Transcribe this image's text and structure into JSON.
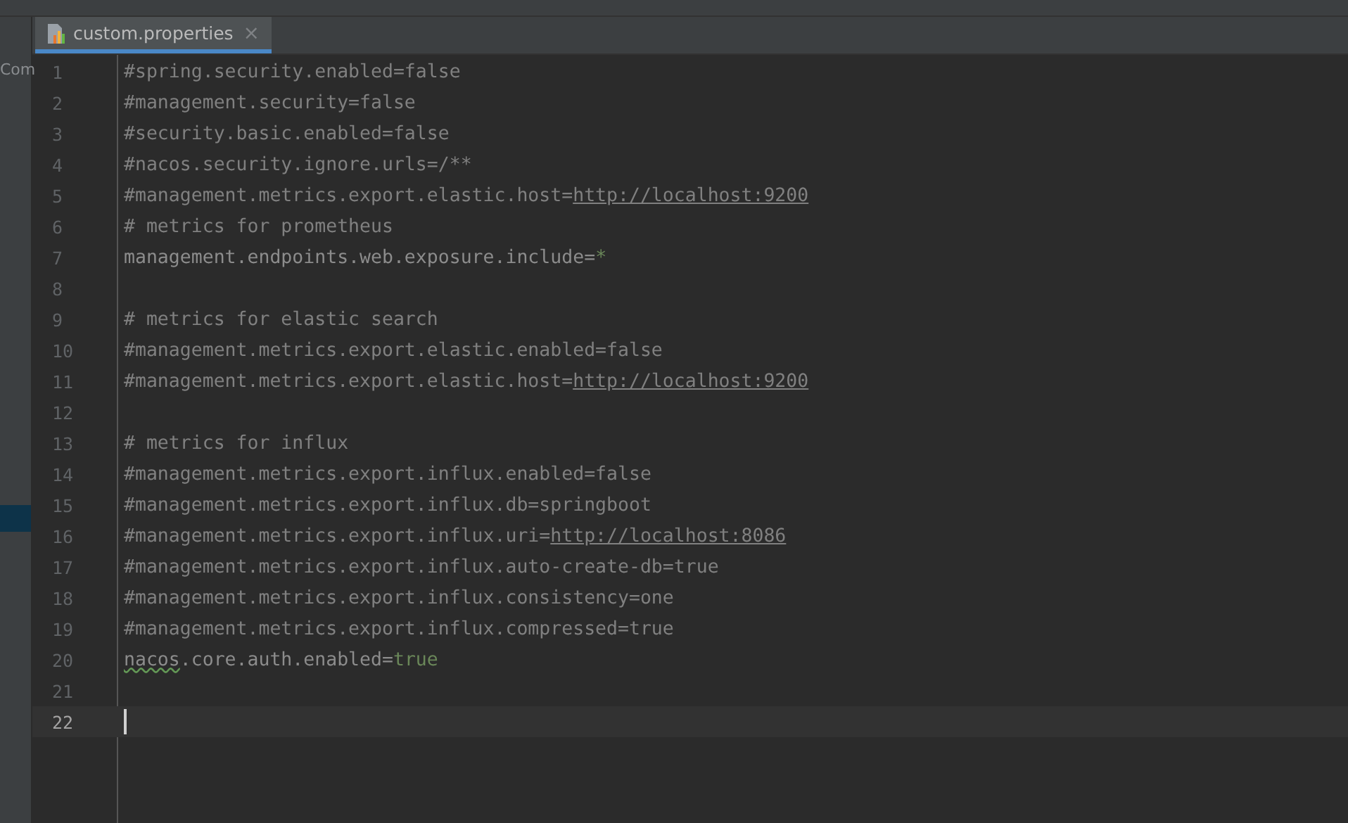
{
  "side_panel": {
    "text": "Com"
  },
  "tabs": [
    {
      "label": "custom.properties",
      "close": "×",
      "selected": true
    }
  ],
  "editor": {
    "lines": [
      {
        "number": "1",
        "current": false,
        "segments": [
          {
            "kind": "comment",
            "text": "#spring.security.enabled=false"
          }
        ]
      },
      {
        "number": "2",
        "current": false,
        "segments": [
          {
            "kind": "comment",
            "text": "#management.security=false"
          }
        ]
      },
      {
        "number": "3",
        "current": false,
        "segments": [
          {
            "kind": "comment",
            "text": "#security.basic.enabled=false"
          }
        ]
      },
      {
        "number": "4",
        "current": false,
        "segments": [
          {
            "kind": "comment",
            "text": "#nacos.security.ignore.urls=/**"
          }
        ]
      },
      {
        "number": "5",
        "current": false,
        "segments": [
          {
            "kind": "comment",
            "text": "#management.metrics.export.elastic.host="
          },
          {
            "kind": "url",
            "text": "http://localhost:9200"
          }
        ]
      },
      {
        "number": "6",
        "current": false,
        "segments": [
          {
            "kind": "comment",
            "text": "# metrics for prometheus"
          }
        ]
      },
      {
        "number": "7",
        "current": false,
        "segments": [
          {
            "kind": "key",
            "text": "management.endpoints.web.exposure.include"
          },
          {
            "kind": "sep",
            "text": "="
          },
          {
            "kind": "value",
            "text": "*"
          }
        ]
      },
      {
        "number": "8",
        "current": false
      },
      {
        "number": "9",
        "current": false,
        "segments": [
          {
            "kind": "comment",
            "text": "# metrics for elastic search"
          }
        ]
      },
      {
        "number": "10",
        "current": false,
        "segments": [
          {
            "kind": "comment",
            "text": "#management.metrics.export.elastic.enabled=false"
          }
        ]
      },
      {
        "number": "11",
        "current": false,
        "segments": [
          {
            "kind": "comment",
            "text": "#management.metrics.export.elastic.host="
          },
          {
            "kind": "url",
            "text": "http://localhost:9200"
          }
        ]
      },
      {
        "number": "12",
        "current": false
      },
      {
        "number": "13",
        "current": false,
        "segments": [
          {
            "kind": "comment",
            "text": "# metrics for influx"
          }
        ]
      },
      {
        "number": "14",
        "current": false,
        "segments": [
          {
            "kind": "comment",
            "text": "#management.metrics.export.influx.enabled=false"
          }
        ]
      },
      {
        "number": "15",
        "current": false,
        "segments": [
          {
            "kind": "comment",
            "text": "#management.metrics.export.influx.db=springboot"
          }
        ]
      },
      {
        "number": "16",
        "current": false,
        "segments": [
          {
            "kind": "comment",
            "text": "#management.metrics.export.influx.uri="
          },
          {
            "kind": "url",
            "text": "http://localhost:8086"
          }
        ]
      },
      {
        "number": "17",
        "current": false,
        "segments": [
          {
            "kind": "comment",
            "text": "#management.metrics.export.influx.auto-create-db=true"
          }
        ]
      },
      {
        "number": "18",
        "current": false,
        "segments": [
          {
            "kind": "comment",
            "text": "#management.metrics.export.influx.consistency=one"
          }
        ]
      },
      {
        "number": "19",
        "current": false,
        "segments": [
          {
            "kind": "comment",
            "text": "#management.metrics.export.influx.compressed=true"
          }
        ]
      },
      {
        "number": "20",
        "current": false,
        "segments": [
          {
            "kind": "typo",
            "text": "nacos"
          },
          {
            "kind": "key",
            "text": ".core.auth.enabled"
          },
          {
            "kind": "sep",
            "text": "="
          },
          {
            "kind": "value",
            "text": "true"
          }
        ]
      },
      {
        "number": "21",
        "current": false
      },
      {
        "number": "22",
        "current": true
      }
    ]
  }
}
